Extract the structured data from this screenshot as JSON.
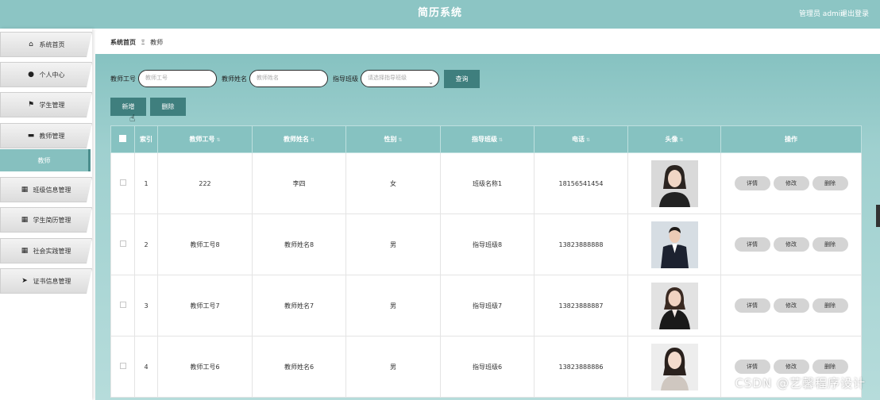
{
  "header": {
    "title": "简历系统",
    "user": "管理员 admin",
    "logout": "退出登录"
  },
  "sidebar": {
    "items": [
      {
        "label": "系统首页",
        "icon": "home-icon",
        "glyph": "⌂"
      },
      {
        "label": "个人中心",
        "icon": "user-icon",
        "glyph": "●"
      },
      {
        "label": "学生管理",
        "icon": "flag-icon",
        "glyph": "⚑"
      },
      {
        "label": "教师管理",
        "icon": "chat-icon",
        "glyph": "▬"
      },
      {
        "label": "班级信息管理",
        "icon": "grid-icon",
        "glyph": "▦"
      },
      {
        "label": "学生简历管理",
        "icon": "grid-icon",
        "glyph": "▦"
      },
      {
        "label": "社会实践管理",
        "icon": "grid-icon",
        "glyph": "▦"
      },
      {
        "label": "证书信息管理",
        "icon": "send-icon",
        "glyph": "➤"
      }
    ],
    "active_sub": "教师"
  },
  "breadcrumb": {
    "home": "系统首页",
    "sep": "Ξ",
    "current": "教师"
  },
  "search": {
    "id_label": "教师工号",
    "id_placeholder": "教师工号",
    "name_label": "教师姓名",
    "name_placeholder": "教师姓名",
    "class_label": "指导班级",
    "class_placeholder": "请选择指导班级",
    "query_button": "查询"
  },
  "actions": {
    "add": "新增",
    "delete": "删除"
  },
  "table": {
    "columns": [
      "索引",
      "教师工号",
      "教师姓名",
      "性别",
      "指导班级",
      "电话",
      "头像",
      "操作"
    ],
    "rows": [
      {
        "index": "1",
        "id": "222",
        "name": "李四",
        "gender": "女",
        "class": "班级名称1",
        "phone": "18156541454"
      },
      {
        "index": "2",
        "id": "教师工号8",
        "name": "教师姓名8",
        "gender": "男",
        "class": "指导班级8",
        "phone": "13823888888"
      },
      {
        "index": "3",
        "id": "教师工号7",
        "name": "教师姓名7",
        "gender": "男",
        "class": "指导班级7",
        "phone": "13823888887"
      },
      {
        "index": "4",
        "id": "教师工号6",
        "name": "教师姓名6",
        "gender": "男",
        "class": "指导班级6",
        "phone": "13823888886"
      }
    ],
    "row_actions": {
      "detail": "详情",
      "edit": "修改",
      "delete": "删除"
    }
  },
  "watermark": "CSDN @艺馨程序设计",
  "colors": {
    "header": "#8cc5c4",
    "accent": "#86c2c1",
    "button": "#3f7f7e"
  }
}
